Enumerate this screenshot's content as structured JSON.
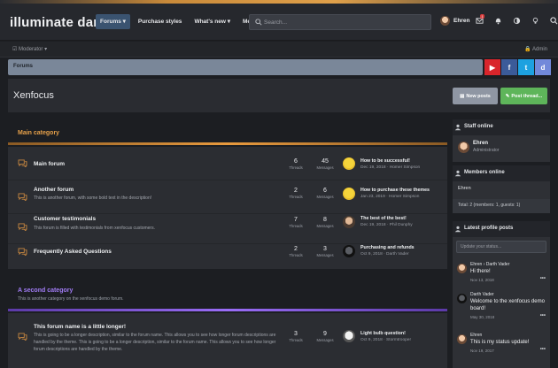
{
  "app": {
    "logo": "illuminate dark"
  },
  "nav": {
    "items": [
      "Forums",
      "Purchase styles",
      "What's new",
      "Members"
    ]
  },
  "search": {
    "placeholder": "Search..."
  },
  "user": {
    "name": "Ehren",
    "alerts_count": "1"
  },
  "subbar": {
    "moderator": "Moderator",
    "admin": "Admin"
  },
  "breadcrumb": {
    "item": "Forums"
  },
  "social": {
    "youtube": "▶",
    "facebook": "f",
    "twitter": "t",
    "discord": "d"
  },
  "page": {
    "title": "Xenfocus",
    "new_posts": "New posts",
    "post_thread": "Post thread..."
  },
  "colors": {
    "accent_orange": "#e0a04a",
    "accent_purple": "#8a5cf0",
    "nav_active": "#3a5370",
    "green": "#5eb55a"
  },
  "categories": [
    {
      "title": "Main category",
      "description": "",
      "forums": [
        {
          "name": "Main forum",
          "description": "",
          "threads": "6",
          "messages": "45",
          "latest_title": "How to be successful!",
          "latest_meta": "Dec 19, 2018 · Homer Simpson",
          "avatar": "homer"
        },
        {
          "name": "Another forum",
          "description": "This is another forum, with some bold text in the description!",
          "threads": "2",
          "messages": "6",
          "latest_title": "How to purchase these themes",
          "latest_meta": "Jan 23, 2019 · Homer Simpson",
          "avatar": "homer"
        },
        {
          "name": "Customer testimonials",
          "description": "This forum is filled with testimonials from xenfocus customers.",
          "threads": "7",
          "messages": "8",
          "latest_title": "The best of the best!",
          "latest_meta": "Dec 19, 2018 · Phil Dunphy",
          "avatar": "phil"
        },
        {
          "name": "Frequently Asked Questions",
          "description": "",
          "threads": "2",
          "messages": "3",
          "latest_title": "Purchasing and refunds",
          "latest_meta": "Oct 9, 2018 · Darth Vader",
          "avatar": "vader"
        }
      ]
    },
    {
      "title": "A second category",
      "description": "This is another category on the xenfocus demo forum.",
      "forums": [
        {
          "name": "This forum name is a little longer!",
          "description": "This is going to be a longer description, similar to the forum name. This allows you to see how longer forum descriptions are handled by the theme. This is going to be a longer description, similar to the forum name. This allows you to see how longer forum descriptions are handled by the theme.",
          "threads": "3",
          "messages": "9",
          "latest_title": "Light bulb question!",
          "latest_meta": "Oct 9, 2018 · Stormtrooper",
          "avatar": "trooper"
        }
      ]
    }
  ],
  "labels": {
    "threads": "Threads",
    "messages": "Messages"
  },
  "sidebar": {
    "staff": {
      "title": "Staff online",
      "name": "Ehren",
      "role": "Administrator"
    },
    "members": {
      "title": "Members online",
      "name": "Ehren",
      "total": "Total: 2 (members: 1, guests: 1)"
    },
    "profile_posts": {
      "title": "Latest profile posts",
      "placeholder": "Update your status...",
      "posts": [
        {
          "name": "Ehren › Darth Vader",
          "text": "Hi there!",
          "date": "Nov 13, 2018"
        },
        {
          "name": "Darth Vader",
          "text": "Welcome to the xenfocus demo board!",
          "date": "May 30, 2018"
        },
        {
          "name": "Ehren",
          "text": "This is my status update!",
          "date": "Nov 19, 2017"
        }
      ]
    }
  }
}
